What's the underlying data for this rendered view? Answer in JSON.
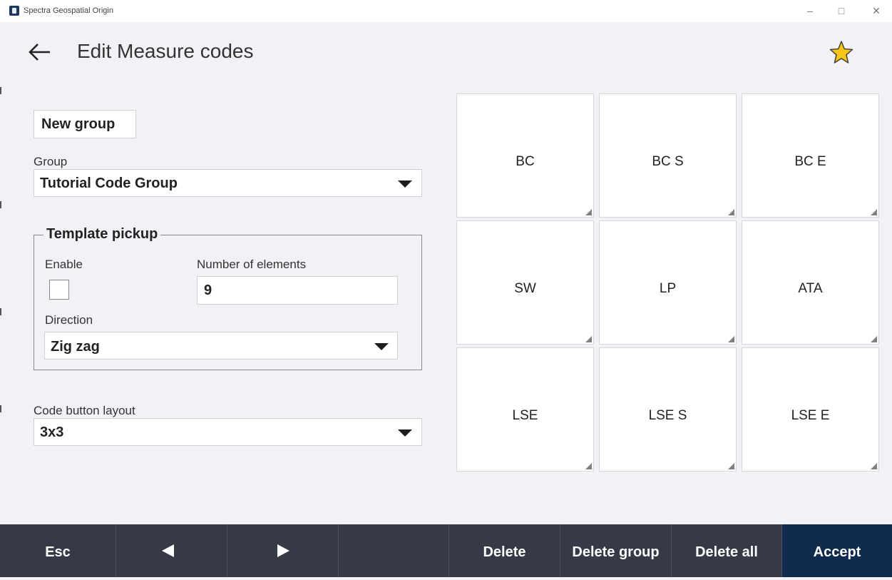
{
  "window": {
    "title": "Spectra Geospatial Origin",
    "controls": {
      "minimize": "–",
      "maximize": "□",
      "close": "✕"
    }
  },
  "header": {
    "title": "Edit Measure codes",
    "back_icon": "back-arrow-icon",
    "favorite_icon": "star-icon",
    "star_color": "#f5c518"
  },
  "form": {
    "new_group_label": "New group",
    "group": {
      "label": "Group",
      "value": "Tutorial Code Group"
    },
    "template_pickup": {
      "title": "Template pickup",
      "enable_label": "Enable",
      "enable_checked": false,
      "elements_label": "Number of elements",
      "elements_value": "9",
      "direction_label": "Direction",
      "direction_value": "Zig zag"
    },
    "layout": {
      "label": "Code button layout",
      "value": "3x3"
    }
  },
  "codes": [
    "BC",
    "BC S",
    "BC E",
    "SW",
    "LP",
    "ATA",
    "LSE",
    "LSE S",
    "LSE E"
  ],
  "bottom_bar": {
    "esc": "Esc",
    "prev_icon": "previous-triangle-icon",
    "next_icon": "next-triangle-icon",
    "delete": "Delete",
    "delete_group": "Delete group",
    "delete_all": "Delete all",
    "accept": "Accept",
    "bar_color": "#363946",
    "accept_color": "#0f2b4e"
  }
}
